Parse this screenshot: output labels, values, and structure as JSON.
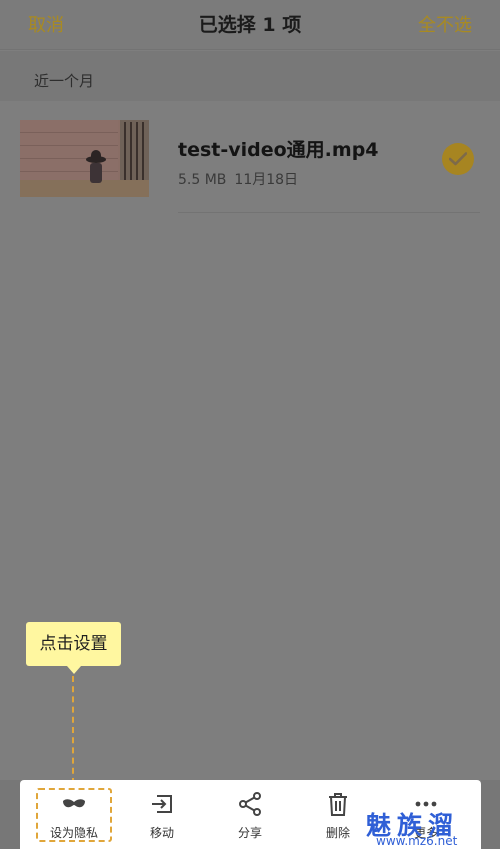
{
  "header": {
    "cancel_label": "取消",
    "title": "已选择 1 项",
    "deselect_label": "全不选"
  },
  "section": {
    "label": "近一个月"
  },
  "file": {
    "name": "test-video通用.mp4",
    "size": "5.5 MB",
    "date": "11月18日",
    "selected": true
  },
  "tooltip": {
    "text": "点击设置"
  },
  "actions": [
    {
      "label": "设为隐私",
      "icon": "mask-icon"
    },
    {
      "label": "移动",
      "icon": "move-icon"
    },
    {
      "label": "分享",
      "icon": "share-icon"
    },
    {
      "label": "删除",
      "icon": "trash-icon"
    },
    {
      "label": "更多",
      "icon": "more-icon"
    }
  ],
  "watermark": {
    "brand": "魅族溜",
    "url": "www.mz6.net"
  },
  "colors": {
    "accent": "#a88a22",
    "overlay": "#7e7e7e",
    "tooltip_bg": "#fff7a0",
    "dashed_highlight": "#e0a63a",
    "watermark": "#2f5fd6"
  }
}
